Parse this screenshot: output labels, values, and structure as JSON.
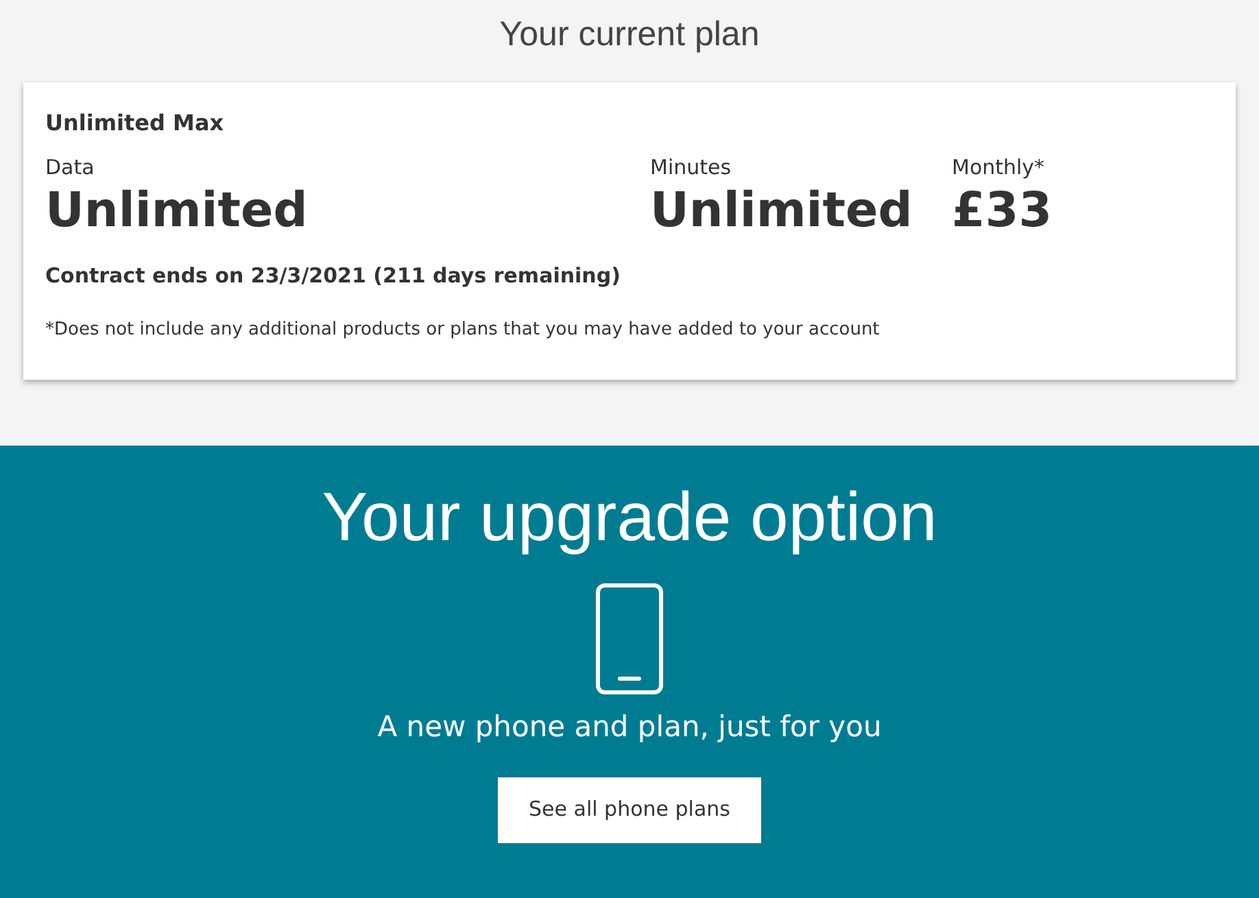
{
  "current_plan": {
    "heading": "Your current plan",
    "plan_name": "Unlimited Max",
    "stats": [
      {
        "label": "Data",
        "value": "Unlimited"
      },
      {
        "label": "Minutes",
        "value": "Unlimited"
      },
      {
        "label": "Monthly*",
        "value": "£33"
      }
    ],
    "contract": "Contract ends on 23/3/2021 (211 days remaining)",
    "footnote": "*Does not include any additional products or plans that you may have added to your account"
  },
  "upgrade": {
    "heading": "Your upgrade option",
    "tagline": "A new phone and plan, just for you",
    "button": "See all phone plans"
  }
}
